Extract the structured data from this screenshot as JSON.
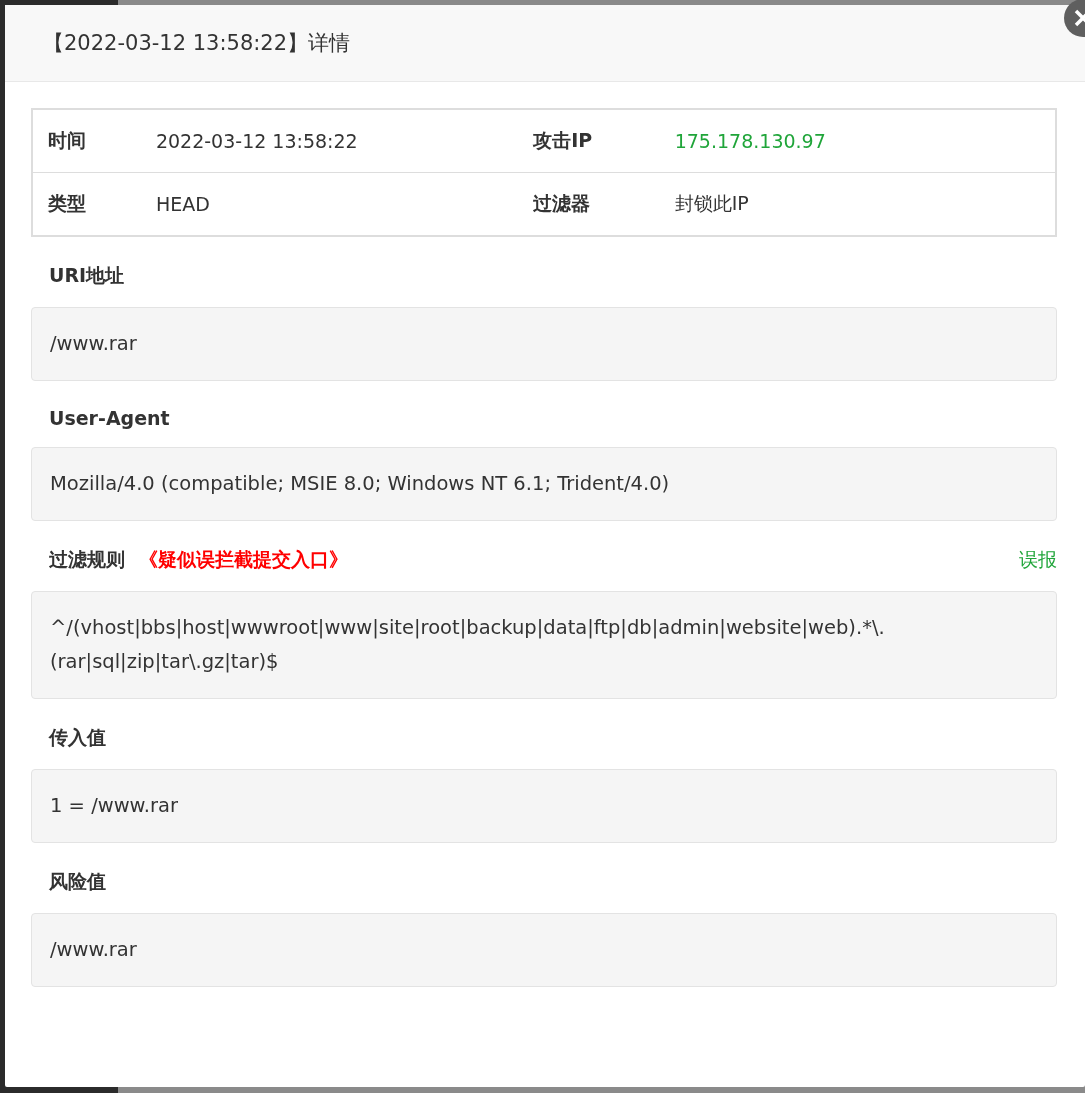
{
  "dialog": {
    "title": "【2022-03-12 13:58:22】详情"
  },
  "info_table": [
    {
      "label": "时间",
      "value": "2022-03-12 13:58:22",
      "label_2": "攻击IP",
      "value_2": "175.178.130.97"
    },
    {
      "label": "类型",
      "value": "HEAD",
      "label_2": "过滤器",
      "value_2": "封锁此IP"
    }
  ],
  "sections": [
    {
      "label": "URI地址",
      "value": "/www.rar"
    },
    {
      "label": "User-Agent",
      "value": "Mozilla/4.0 (compatible; MSIE 8.0; Windows NT 6.1; Trident/4.0)"
    },
    {
      "label": "过滤规则",
      "note": "《疑似误拦截提交入口》",
      "link": "误报",
      "value": "^/(vhost|bbs|host|wwwroot|www|site|root|backup|data|ftp|db|admin|website|web).*\\.(rar|sql|zip|tar\\.gz|tar)$"
    },
    {
      "label": "传入值",
      "value": "1 = /www.rar"
    },
    {
      "label": "风险值",
      "value": "/www.rar"
    }
  ]
}
